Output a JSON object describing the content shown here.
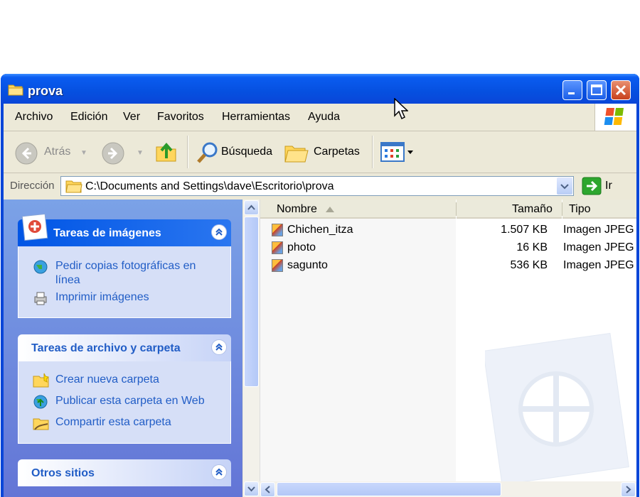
{
  "window": {
    "title": "prova"
  },
  "menu": [
    "Archivo",
    "Edición",
    "Ver",
    "Favoritos",
    "Herramientas",
    "Ayuda"
  ],
  "toolbar": {
    "back": "Atrás",
    "search": "Búsqueda",
    "folders": "Carpetas"
  },
  "address": {
    "label": "Dirección",
    "value": "C:\\Documents and Settings\\dave\\Escritorio\\prova",
    "go": "Ir"
  },
  "tasks": {
    "images": {
      "title": "Tareas de imágenes",
      "items": [
        "Pedir copias fotográficas en línea",
        "Imprimir imágenes"
      ]
    },
    "files": {
      "title": "Tareas de archivo y carpeta",
      "items": [
        "Crear nueva carpeta",
        "Publicar esta carpeta en Web",
        "Compartir esta carpeta"
      ]
    },
    "other": {
      "title": "Otros sitios"
    }
  },
  "columns": {
    "name": "Nombre",
    "size": "Tamaño",
    "type": "Tipo"
  },
  "files": [
    {
      "name": "Chichen_itza",
      "size": "1.507 KB",
      "type": "Imagen JPEG"
    },
    {
      "name": "photo",
      "size": "16 KB",
      "type": "Imagen JPEG"
    },
    {
      "name": "sagunto",
      "size": "536 KB",
      "type": "Imagen JPEG"
    }
  ],
  "colors": {
    "titlebar": "#0a46d8",
    "taskpane": "#6f8ee0",
    "link": "#215dc6"
  }
}
